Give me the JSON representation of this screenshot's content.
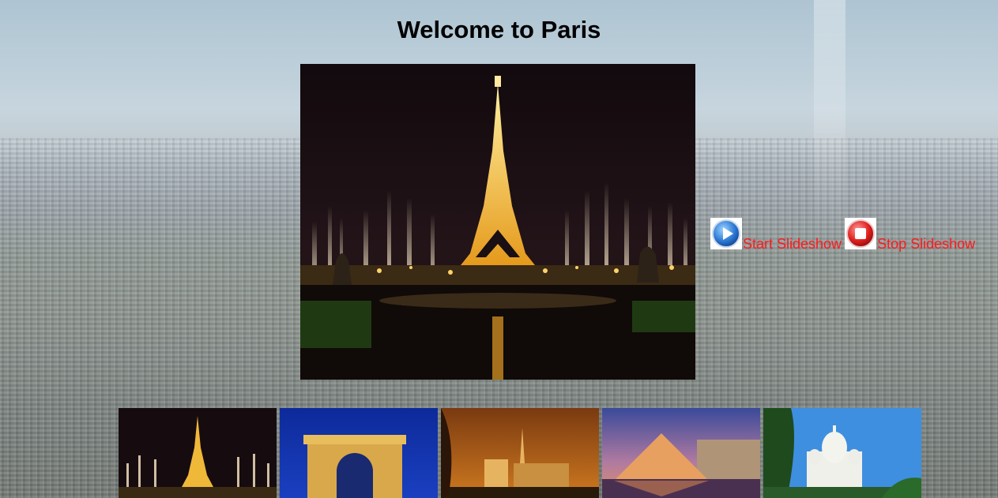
{
  "page": {
    "title": "Welcome to Paris"
  },
  "main_image": {
    "icon": "eiffel-tower-night-photo"
  },
  "controls": {
    "start_label": "Start Slideshow",
    "stop_label": "Stop Slideshow",
    "start_icon": "play-icon",
    "stop_icon": "stop-icon",
    "label_color": "#ff1a1a"
  },
  "thumbnails": [
    {
      "icon": "eiffel-tower-thumb"
    },
    {
      "icon": "arc-de-triomphe-thumb"
    },
    {
      "icon": "notre-dame-thumb"
    },
    {
      "icon": "louvre-pyramid-thumb"
    },
    {
      "icon": "sacre-coeur-thumb"
    }
  ]
}
